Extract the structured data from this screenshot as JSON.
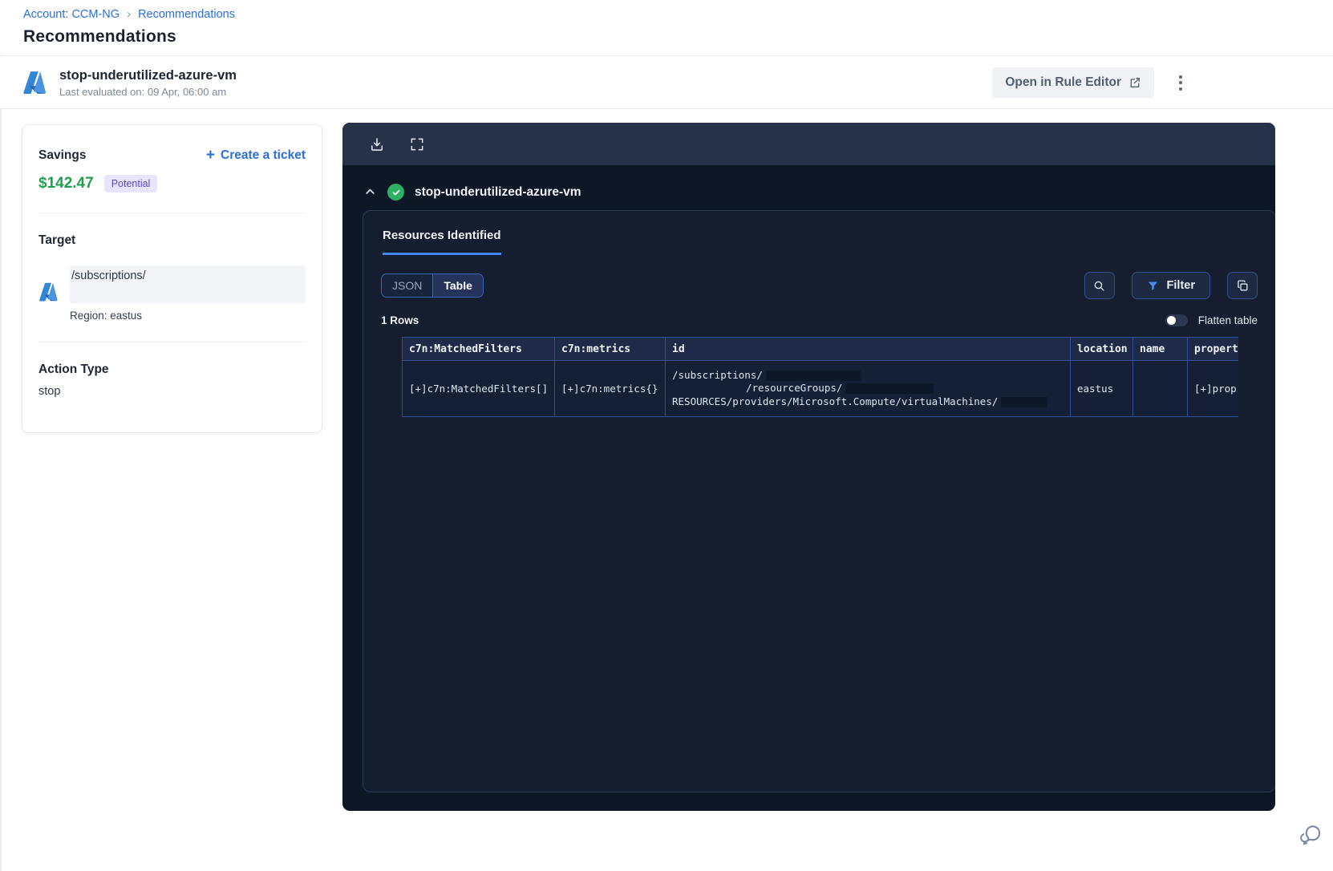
{
  "colors": {
    "accent_blue": "#2a6fd6",
    "savings_green": "#1fa24d",
    "badge_bg": "#e7e4fb",
    "badge_text": "#5b49c9",
    "panel_bg": "#0e1726",
    "toolbar_bg": "#263248",
    "table_border": "#2f4f96",
    "success_green": "#2eb062",
    "filter_icon_blue": "#4d8fe8"
  },
  "breadcrumb": {
    "account": "Account: CCM-NG",
    "separator": "›",
    "current": "Recommendations"
  },
  "page": {
    "title": "Recommendations"
  },
  "rule_header": {
    "title": "stop-underutilized-azure-vm",
    "last_evaluated": "Last evaluated on: 09 Apr, 06:00 am",
    "open_in_rule_editor": "Open in Rule Editor"
  },
  "details_card": {
    "savings_label": "Savings",
    "savings_amount": "$142.47",
    "savings_badge": "Potential",
    "create_ticket_plus": "+",
    "create_ticket_label": "Create a ticket",
    "target_label": "Target",
    "target_path": "/subscriptions/",
    "target_region": "Region: eastus",
    "action_type_label": "Action Type",
    "action_type_value": "stop"
  },
  "resource_panel": {
    "rule_title": "stop-underutilized-azure-vm",
    "tab_label": "Resources Identified",
    "view_toggle": {
      "json_label": "JSON",
      "table_label": "Table"
    },
    "filter_label": "Filter",
    "rows_count": "1 Rows",
    "flatten_label": "Flatten table",
    "table": {
      "columns": [
        "c7n:MatchedFilters",
        "c7n:metrics",
        "id",
        "location",
        "name",
        "propert"
      ],
      "row": {
        "matched_filters": "[+]c7n:MatchedFilters[]",
        "metrics": "[+]c7n:metrics{}",
        "id_line1": "/subscriptions/",
        "id_line2": "/resourceGroups/",
        "id_line3": "RESOURCES/providers/Microsoft.Compute/virtualMachines/",
        "location": "eastus",
        "name": "",
        "properties": "[+]prop"
      }
    }
  }
}
